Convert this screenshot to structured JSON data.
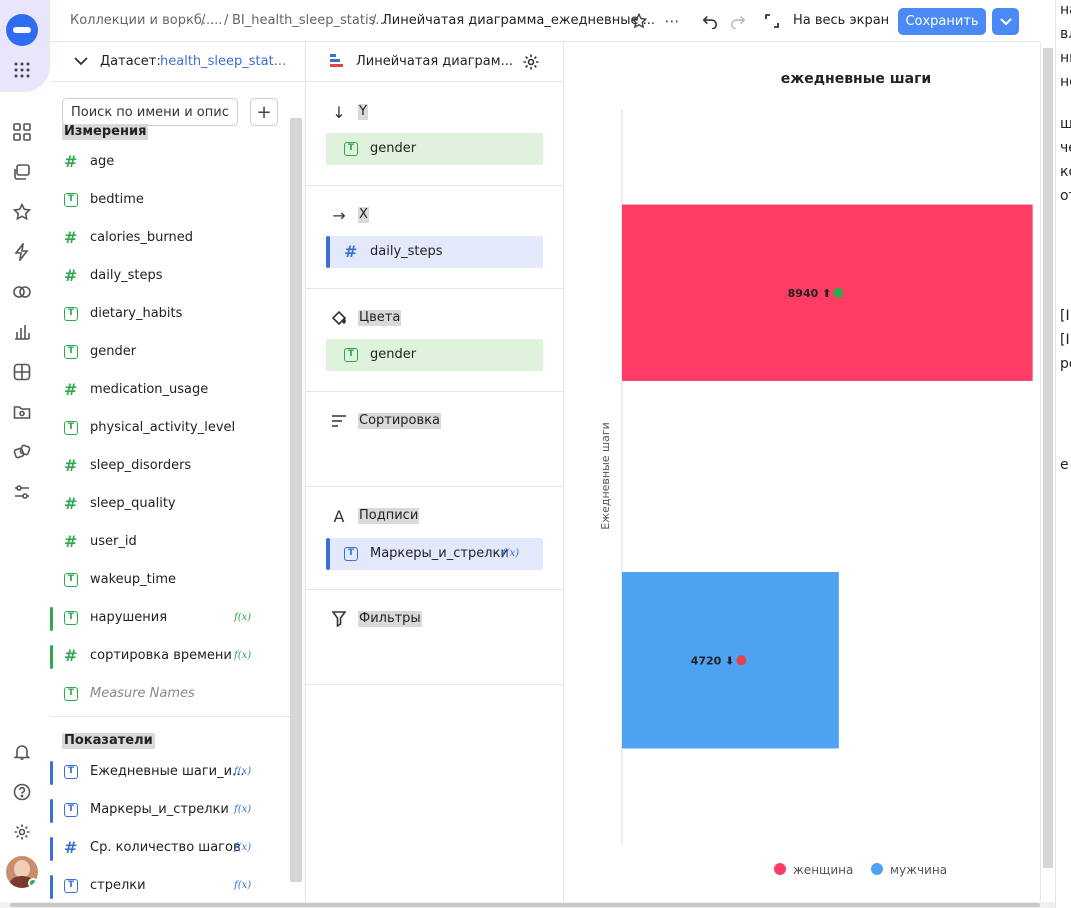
{
  "topbar": {
    "crumbs": [
      "Коллекции и воркб...",
      "/",
      "...",
      "/",
      "BI_health_sleep_statis...",
      "/"
    ],
    "current": "Линейчатая диаграмма_ежедневные ...",
    "fullscreen_label": "На весь экран",
    "save_label": "Сохранить"
  },
  "dataset": {
    "label": "Датасет:",
    "name": "health_sleep_stat...",
    "search_placeholder": "Поиск по имени и описанию",
    "add_label": "+",
    "dimensions_title": "Измерения",
    "dimensions": [
      {
        "label": "age",
        "type": "num"
      },
      {
        "label": "bedtime",
        "type": "text"
      },
      {
        "label": "calories_burned",
        "type": "num"
      },
      {
        "label": "daily_steps",
        "type": "num"
      },
      {
        "label": "dietary_habits",
        "type": "text"
      },
      {
        "label": "gender",
        "type": "text"
      },
      {
        "label": "medication_usage",
        "type": "num"
      },
      {
        "label": "physical_activity_level",
        "type": "text"
      },
      {
        "label": "sleep_disorders",
        "type": "num"
      },
      {
        "label": "sleep_quality",
        "type": "num"
      },
      {
        "label": "user_id",
        "type": "num"
      },
      {
        "label": "wakeup_time",
        "type": "text"
      },
      {
        "label": "нарушения",
        "type": "text",
        "fx": "f(x)"
      },
      {
        "label": "сортировка времени",
        "type": "num",
        "fx": "f(x)"
      },
      {
        "label": "Measure Names",
        "type": "text"
      }
    ],
    "measures_title": "Показатели",
    "measures": [
      {
        "label": "Ежедневные шаги_и...",
        "type": "text",
        "fx": "f(x)"
      },
      {
        "label": "Маркеры_и_стрелки",
        "type": "text",
        "fx": "f(x)"
      },
      {
        "label": "Ср. количество шагов",
        "type": "num",
        "fx": "f(x)"
      },
      {
        "label": "стрелки",
        "type": "text",
        "fx": "f(x)"
      }
    ]
  },
  "sections": {
    "header_title": "Линейчатая диаграм...",
    "y": {
      "title": "Y",
      "chip": "gender"
    },
    "x": {
      "title": "X",
      "chip": "daily_steps"
    },
    "colors": {
      "title": "Цвета",
      "chip": "gender"
    },
    "sort": {
      "title": "Сортировка"
    },
    "labels": {
      "title": "Подписи",
      "chip": "Маркеры_и_стрелки",
      "fx": "f(x)"
    },
    "filters": {
      "title": "Фильтры"
    }
  },
  "colors": {
    "accent": "#4b8af5",
    "female": "#ff3d64",
    "male": "#4da2f1",
    "green": "#2fa84f"
  },
  "chart_data": {
    "type": "bar",
    "orientation": "horizontal",
    "title": "ежедневные шаги",
    "ylabel": "Ежедневные шаги",
    "categories": [
      "женщина",
      "мужчина"
    ],
    "values": [
      8940,
      4720
    ],
    "labels": [
      "8940 ⬆",
      "4720 ⬇"
    ],
    "marker_colors": [
      "#2fa84f",
      "#e0434a"
    ],
    "series_colors": [
      "#ff3d64",
      "#4da2f1"
    ],
    "legend": [
      "женщина",
      "мужчина"
    ],
    "legend_position": "bottom",
    "xlim": [
      0,
      9100
    ]
  },
  "right_clip": {
    "lines": [
      "на",
      "вл",
      "ны",
      "не",
      "ше",
      "че",
      "ко",
      "от",
      "[IN",
      "[IN",
      "рел",
      "е п"
    ]
  }
}
